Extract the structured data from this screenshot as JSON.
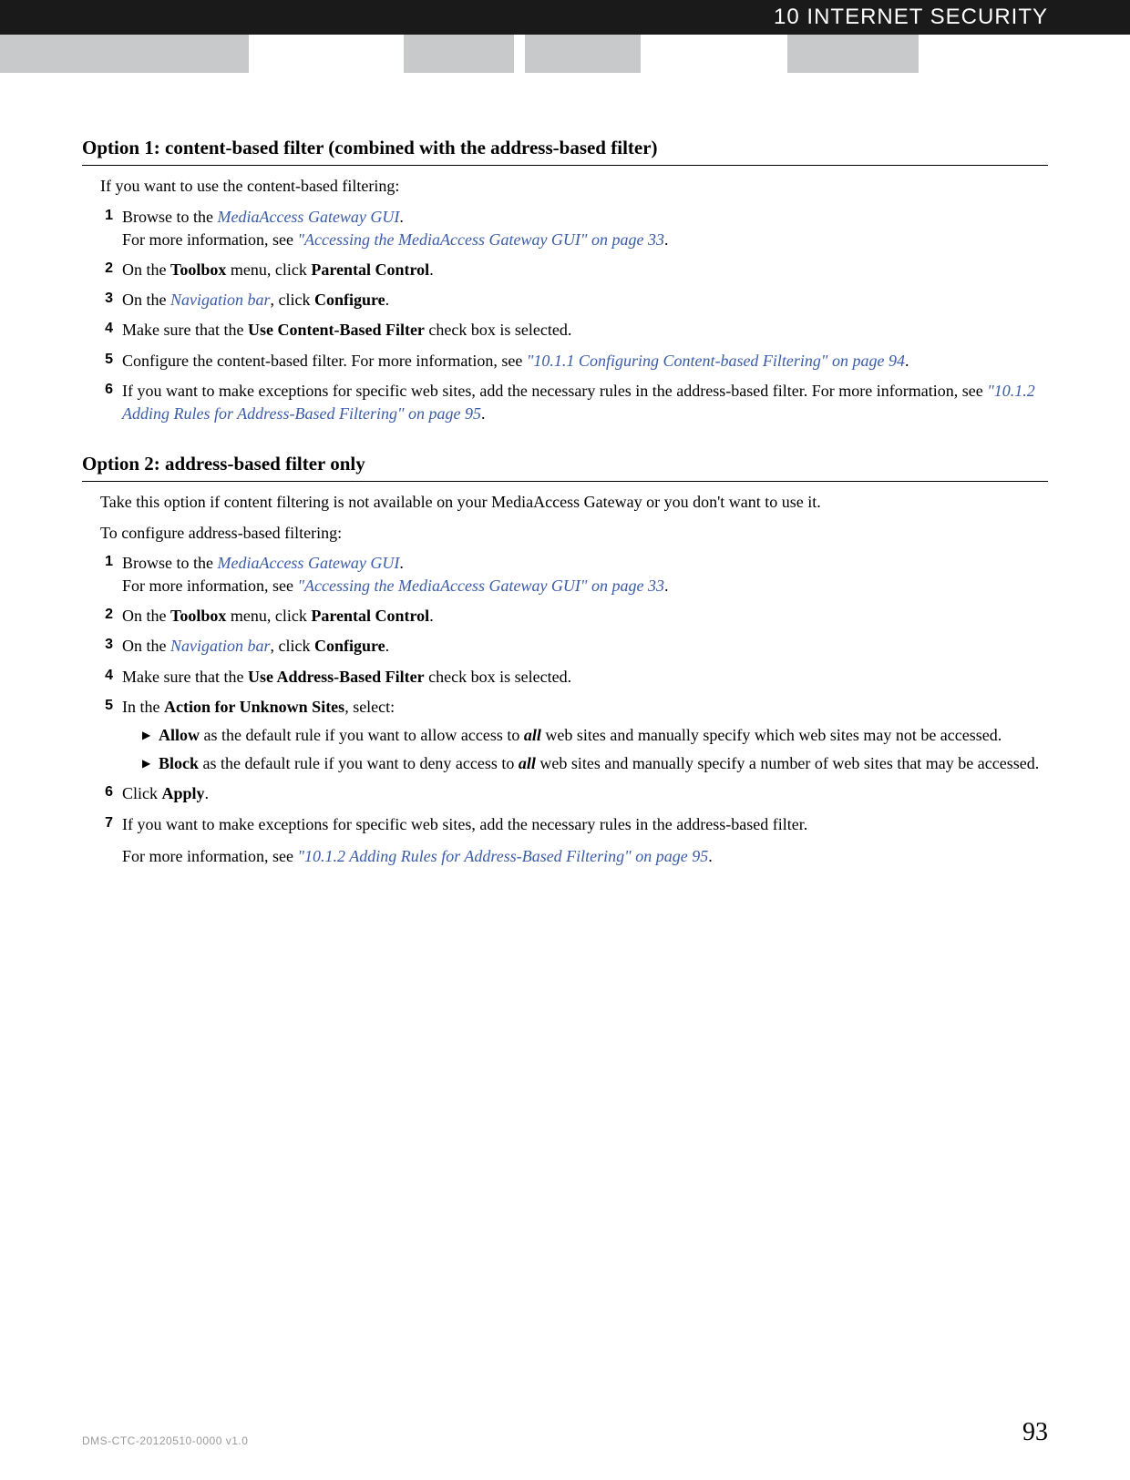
{
  "header": {
    "title": "10 INTERNET SECURITY"
  },
  "option1": {
    "heading": "Option 1: content-based filter (combined with the address-based filter)",
    "intro": "If you want to use the content-based filtering:",
    "steps": {
      "s1": {
        "num": "1",
        "t1": "Browse to the ",
        "link1": "MediaAccess Gateway GUI",
        "t2": ".",
        "t3": "For more information, see ",
        "link2": "\"Accessing the MediaAccess Gateway GUI\" on page 33",
        "t4": "."
      },
      "s2": {
        "num": "2",
        "t1": "On the ",
        "b1": "Toolbox",
        "t2": " menu, click ",
        "b2": "Parental Control",
        "t3": "."
      },
      "s3": {
        "num": "3",
        "t1": "On the ",
        "link1": "Navigation bar",
        "t2": ", click ",
        "b1": "Configure",
        "t3": "."
      },
      "s4": {
        "num": "4",
        "t1": "Make sure that the ",
        "b1": "Use Content-Based Filter",
        "t2": " check box is selected."
      },
      "s5": {
        "num": "5",
        "t1": "Configure the content-based filter. For more information, see ",
        "link1": "\"10.1.1 Configuring Content-based Filtering\" on page 94",
        "t2": "."
      },
      "s6": {
        "num": "6",
        "t1": "If you want to make exceptions for specific web sites, add the necessary rules in the address-based filter. For more information, see ",
        "link1": "\"10.1.2 Adding Rules for Address-Based Filtering\" on page 95",
        "t2": "."
      }
    }
  },
  "option2": {
    "heading": "Option 2: address-based filter only",
    "intro1": "Take this option if content filtering is not available on your MediaAccess Gateway or you don't want to use it.",
    "intro2": "To configure address-based filtering:",
    "steps": {
      "s1": {
        "num": "1",
        "t1": "Browse to the ",
        "link1": "MediaAccess Gateway GUI",
        "t2": ".",
        "t3": "For more information, see ",
        "link2": "\"Accessing the MediaAccess Gateway GUI\" on page 33",
        "t4": "."
      },
      "s2": {
        "num": "2",
        "t1": "On the ",
        "b1": "Toolbox",
        "t2": " menu, click ",
        "b2": "Parental Control",
        "t3": "."
      },
      "s3": {
        "num": "3",
        "t1": "On the ",
        "link1": "Navigation bar",
        "t2": ", click ",
        "b1": "Configure",
        "t3": "."
      },
      "s4": {
        "num": "4",
        "t1": "Make sure that the ",
        "b1": "Use Address-Based Filter",
        "t2": " check box is selected."
      },
      "s5": {
        "num": "5",
        "t1": "In the ",
        "b1": "Action for Unknown Sites",
        "t2": ", select:",
        "sub": {
          "a": {
            "b": "Allow",
            "t1": " as the default rule if you want to allow access to ",
            "bi": "all",
            "t2": " web sites and manually specify which web sites may not be accessed."
          },
          "b": {
            "b": "Block",
            "t1": " as the default rule if you want to deny access to ",
            "bi": "all",
            "t2": " web sites and manually specify a number of web sites that may be accessed."
          }
        }
      },
      "s6": {
        "num": "6",
        "t1": "Click ",
        "b1": "Apply",
        "t2": "."
      },
      "s7": {
        "num": "7",
        "t1": "If you want to make exceptions for specific web sites, add the necessary rules in the address-based filter.",
        "t2": "For more information, see ",
        "link1": "\"10.1.2 Adding Rules for Address-Based Filtering\" on page 95",
        "t3": "."
      }
    }
  },
  "footer": {
    "docid": "DMS-CTC-20120510-0000 v1.0",
    "page": "93"
  }
}
